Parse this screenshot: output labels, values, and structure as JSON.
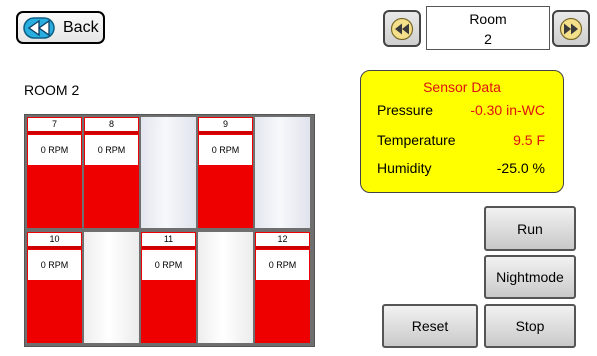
{
  "back_label": "Back",
  "room_selector": {
    "label": "Room",
    "value": "2"
  },
  "page_title": "ROOM 2",
  "sensor": {
    "title": "Sensor Data",
    "pressure_label": "Pressure",
    "pressure_value": "-0.30 in-WC",
    "temperature_label": "Temperature",
    "temperature_value": "9.5 F",
    "humidity_label": "Humidity",
    "humidity_value": "-25.0 %"
  },
  "fans": [
    {
      "number": "7",
      "rpm": "0 RPM"
    },
    {
      "number": "8",
      "rpm": "0 RPM"
    },
    {
      "number": "9",
      "rpm": "0 RPM"
    },
    {
      "number": "10",
      "rpm": "0 RPM"
    },
    {
      "number": "11",
      "rpm": "0 RPM"
    },
    {
      "number": "12",
      "rpm": "0 RPM"
    }
  ],
  "buttons": {
    "run": "Run",
    "nightmode": "Nightmode",
    "reset": "Reset",
    "stop": "Stop"
  },
  "colors": {
    "sensor_bg": "#ffff00",
    "sensor_value": "#dd1111",
    "fan_red": "#ee0000",
    "nav_cyan": "#22aadd"
  },
  "icons": {
    "back": "rewind-icon",
    "prev": "rewind-icon",
    "next": "fast-forward-icon"
  }
}
